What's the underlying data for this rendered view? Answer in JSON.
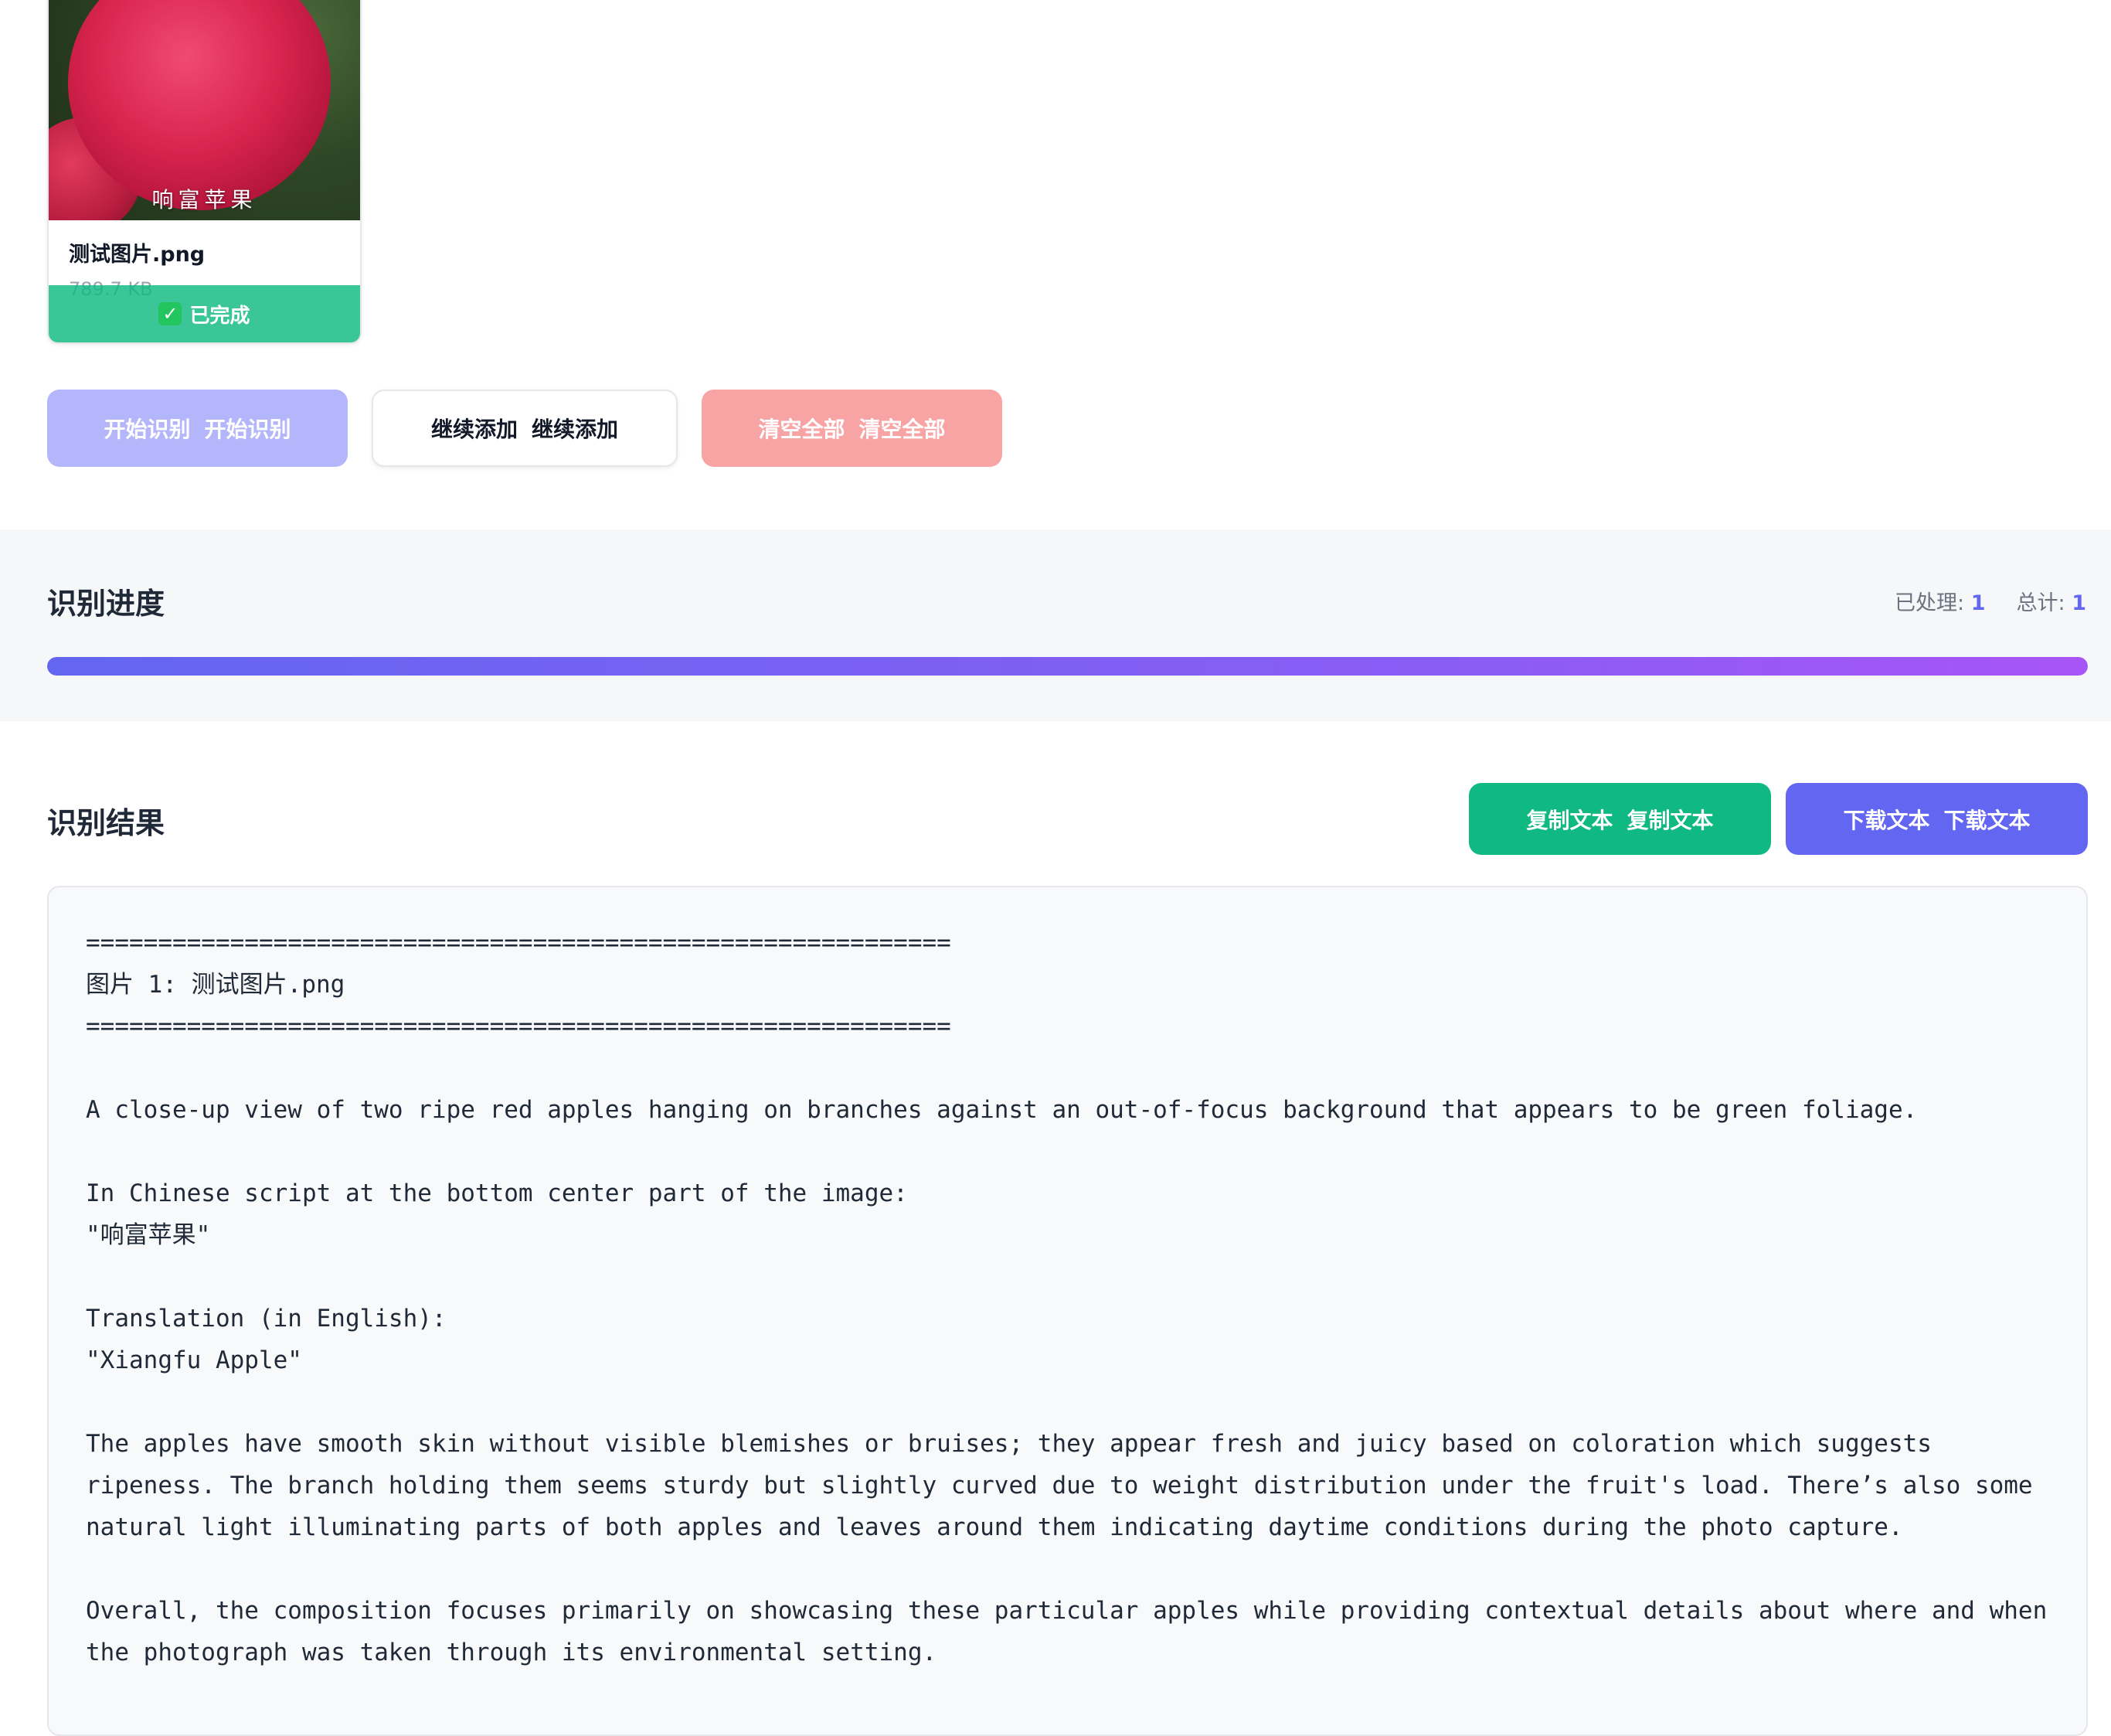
{
  "file_card": {
    "thumbnail_caption": "响富苹果",
    "file_name": "测试图片.png",
    "file_size": "789.7 KB",
    "status_icon": "check-box-icon",
    "status_label": "已完成"
  },
  "actions": {
    "start_label": "开始识别",
    "add_label": "继续添加",
    "clear_label": "清空全部"
  },
  "progress": {
    "title": "识别进度",
    "processed_label": "已处理:",
    "processed_value": "1",
    "total_label": "总计:",
    "total_value": "1",
    "percent": 100
  },
  "result": {
    "title": "识别结果",
    "copy_label": "复制文本",
    "download_label": "下载文本",
    "text": "============================================================\n图片 1: 测试图片.png\n============================================================\n\nA close-up view of two ripe red apples hanging on branches against an out-of-focus background that appears to be green foliage.\n\nIn Chinese script at the bottom center part of the image:\n\"响富苹果\"\n\nTranslation (in English):\n\"Xiangfu Apple\"\n\nThe apples have smooth skin without visible blemishes or bruises; they appear fresh and juicy based on coloration which suggests ripeness. The branch holding them seems sturdy but slightly curved due to weight distribution under the fruit's load. There’s also some natural light illuminating parts of both apples and leaves around them indicating daytime conditions during the photo capture.\n\nOverall, the composition focuses primarily on showcasing these particular apples while providing contextual details about where and when the photograph was taken through its environmental setting."
  },
  "colors": {
    "accent": "#6366f1",
    "success": "#10b981",
    "danger_light": "#f8a4a4",
    "primary_light": "#b4b6fb"
  }
}
